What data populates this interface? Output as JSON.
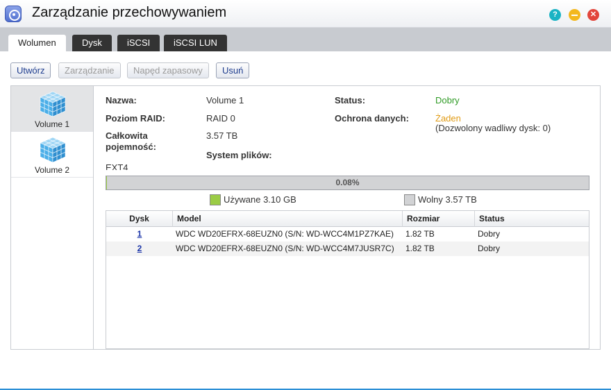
{
  "window": {
    "title": "Zarządzanie przechowywaniem",
    "help_glyph": "?",
    "close_glyph": "✕"
  },
  "tabs": [
    {
      "label": "Wolumen",
      "active": true
    },
    {
      "label": "Dysk",
      "active": false
    },
    {
      "label": "iSCSI",
      "active": false
    },
    {
      "label": "iSCSI LUN",
      "active": false
    }
  ],
  "toolbar": {
    "create": "Utwórz",
    "manage": "Zarządzanie",
    "spare": "Napęd zapasowy",
    "delete": "Usuń"
  },
  "volumes": [
    {
      "label": "Volume 1",
      "selected": true
    },
    {
      "label": "Volume 2",
      "selected": false
    }
  ],
  "details": {
    "name_label": "Nazwa:",
    "name_value": "Volume 1",
    "raid_label": "Poziom RAID:",
    "raid_value": "RAID 0",
    "capacity_label": "Całkowita pojemność:",
    "capacity_value": "3.57 TB",
    "fs_label": "System plików:",
    "fs_value": "EXT4",
    "status_label": "Status:",
    "status_value": "Dobry",
    "protection_label": "Ochrona danych:",
    "protection_value": "Żaden",
    "protection_note": "(Dozwolony wadliwy dysk: 0)"
  },
  "usage": {
    "percent_text": "0.08%",
    "used_fraction": 0.0008,
    "used_label": "Używane 3.10 GB",
    "free_label": "Wolny 3.57 TB",
    "used_color": "#9bcc45",
    "free_color": "#d2d3d5"
  },
  "disk_table": {
    "headers": [
      "Dysk",
      "Model",
      "Rozmiar",
      "Status"
    ],
    "rows": [
      {
        "disk": "1",
        "model": "WDC WD20EFRX-68EUZN0 (S/N: WD-WCC4M1PZ7KAE)",
        "size": "1.82 TB",
        "status": "Dobry"
      },
      {
        "disk": "2",
        "model": "WDC WD20EFRX-68EUZN0 (S/N: WD-WCC4M7JUSR7C)",
        "size": "1.82 TB",
        "status": "Dobry"
      }
    ]
  },
  "colors": {
    "status_good": "#2e9a24",
    "protection_none": "#e09a12",
    "accent": "#2b8fd6"
  }
}
